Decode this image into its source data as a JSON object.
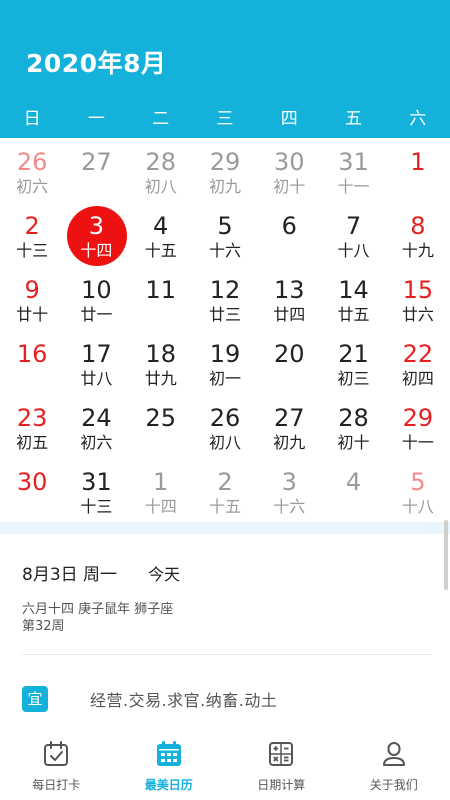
{
  "header": {
    "title": "2020年8月",
    "weekdays": [
      "日",
      "一",
      "二",
      "三",
      "四",
      "五",
      "六"
    ]
  },
  "calendar": {
    "weeks": [
      [
        {
          "day": "26",
          "lunar": "初六",
          "other": true
        },
        {
          "day": "27",
          "lunar": "",
          "other": true
        },
        {
          "day": "28",
          "lunar": "初八",
          "other": true
        },
        {
          "day": "29",
          "lunar": "初九",
          "other": true
        },
        {
          "day": "30",
          "lunar": "初十",
          "other": true
        },
        {
          "day": "31",
          "lunar": "十一",
          "other": true
        },
        {
          "day": "1",
          "lunar": "",
          "other": false
        }
      ],
      [
        {
          "day": "2",
          "lunar": "十三",
          "other": false
        },
        {
          "day": "3",
          "lunar": "十四",
          "other": false,
          "selected": true
        },
        {
          "day": "4",
          "lunar": "十五",
          "other": false
        },
        {
          "day": "5",
          "lunar": "十六",
          "other": false
        },
        {
          "day": "6",
          "lunar": "",
          "other": false
        },
        {
          "day": "7",
          "lunar": "十八",
          "other": false
        },
        {
          "day": "8",
          "lunar": "十九",
          "other": false
        }
      ],
      [
        {
          "day": "9",
          "lunar": "廿十",
          "other": false
        },
        {
          "day": "10",
          "lunar": "廿一",
          "other": false
        },
        {
          "day": "11",
          "lunar": "",
          "other": false
        },
        {
          "day": "12",
          "lunar": "廿三",
          "other": false
        },
        {
          "day": "13",
          "lunar": "廿四",
          "other": false
        },
        {
          "day": "14",
          "lunar": "廿五",
          "other": false
        },
        {
          "day": "15",
          "lunar": "廿六",
          "other": false
        }
      ],
      [
        {
          "day": "16",
          "lunar": "",
          "other": false
        },
        {
          "day": "17",
          "lunar": "廿八",
          "other": false
        },
        {
          "day": "18",
          "lunar": "廿九",
          "other": false
        },
        {
          "day": "19",
          "lunar": "初一",
          "other": false
        },
        {
          "day": "20",
          "lunar": "",
          "other": false
        },
        {
          "day": "21",
          "lunar": "初三",
          "other": false
        },
        {
          "day": "22",
          "lunar": "初四",
          "other": false
        }
      ],
      [
        {
          "day": "23",
          "lunar": "初五",
          "other": false
        },
        {
          "day": "24",
          "lunar": "初六",
          "other": false
        },
        {
          "day": "25",
          "lunar": "",
          "other": false
        },
        {
          "day": "26",
          "lunar": "初八",
          "other": false
        },
        {
          "day": "27",
          "lunar": "初九",
          "other": false
        },
        {
          "day": "28",
          "lunar": "初十",
          "other": false
        },
        {
          "day": "29",
          "lunar": "十一",
          "other": false
        }
      ],
      [
        {
          "day": "30",
          "lunar": "",
          "other": false
        },
        {
          "day": "31",
          "lunar": "十三",
          "other": false
        },
        {
          "day": "1",
          "lunar": "十四",
          "other": true
        },
        {
          "day": "2",
          "lunar": "十五",
          "other": true
        },
        {
          "day": "3",
          "lunar": "十六",
          "other": true
        },
        {
          "day": "4",
          "lunar": "",
          "other": true
        },
        {
          "day": "5",
          "lunar": "十八",
          "other": true
        }
      ]
    ]
  },
  "detail": {
    "date": "8月3日 周一",
    "today": "今天",
    "lunar_info": "六月十四 庚子鼠年 狮子座",
    "week_info": "第32周",
    "yi_label": "宜",
    "yi_text": "经营.交易.求官.纳畜.动土"
  },
  "tabs": [
    {
      "label": "每日打卡",
      "icon": "checkin-calendar-icon",
      "active": false
    },
    {
      "label": "最美日历",
      "icon": "calendar-icon",
      "active": true
    },
    {
      "label": "日期计算",
      "icon": "calculator-icon",
      "active": false
    },
    {
      "label": "关于我们",
      "icon": "user-icon",
      "active": false
    }
  ],
  "colors": {
    "primary": "#14b2da",
    "weekend": "#e62020",
    "selected": "#ee1111"
  }
}
